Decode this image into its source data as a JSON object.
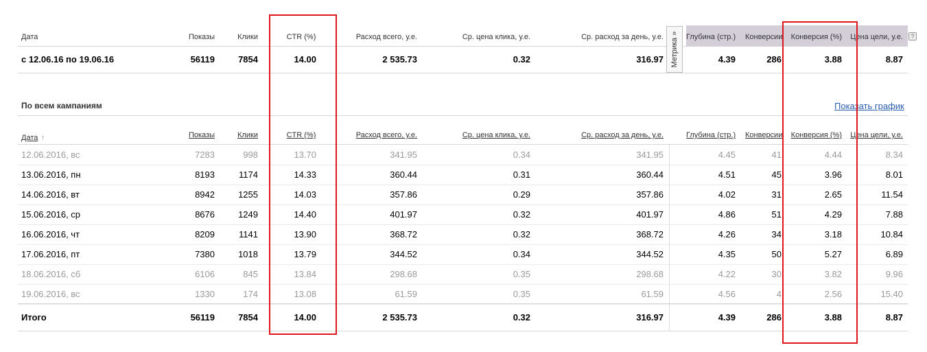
{
  "columns": [
    "Дата",
    "Показы",
    "Клики",
    "CTR (%)",
    "Расход всего, у.е.",
    "Ср. цена клика, у.е.",
    "Ср. расход за день, у.е.",
    "Глубина (стр.)",
    "Конверсии",
    "Конверсия (%)",
    "Цена цели, у.е."
  ],
  "sort_arrow": "↑",
  "metrika_label": "Метрика »",
  "help_label": "?",
  "summary": {
    "date": "с 12.06.16 по 19.06.16",
    "shows": "56119",
    "clicks": "7854",
    "ctr": "14.00",
    "cost": "2 535.73",
    "cpc": "0.32",
    "daily": "316.97",
    "depth": "4.39",
    "conv": "286",
    "conv_pct": "3.88",
    "goal_price": "8.87"
  },
  "section_title": "По всем кампаниям",
  "show_graph": "Показать график",
  "rows": [
    {
      "date": "12.06.2016, вс",
      "shows": "7283",
      "clicks": "998",
      "ctr": "13.70",
      "cost": "341.95",
      "cpc": "0.34",
      "daily": "341.95",
      "depth": "4.45",
      "conv": "41",
      "conv_pct": "4.44",
      "goal_price": "8.34",
      "muted": true
    },
    {
      "date": "13.06.2016, пн",
      "shows": "8193",
      "clicks": "1174",
      "ctr": "14.33",
      "cost": "360.44",
      "cpc": "0.31",
      "daily": "360.44",
      "depth": "4.51",
      "conv": "45",
      "conv_pct": "3.96",
      "goal_price": "8.01",
      "muted": false
    },
    {
      "date": "14.06.2016, вт",
      "shows": "8942",
      "clicks": "1255",
      "ctr": "14.03",
      "cost": "357.86",
      "cpc": "0.29",
      "daily": "357.86",
      "depth": "4.02",
      "conv": "31",
      "conv_pct": "2.65",
      "goal_price": "11.54",
      "muted": false
    },
    {
      "date": "15.06.2016, ср",
      "shows": "8676",
      "clicks": "1249",
      "ctr": "14.40",
      "cost": "401.97",
      "cpc": "0.32",
      "daily": "401.97",
      "depth": "4.86",
      "conv": "51",
      "conv_pct": "4.29",
      "goal_price": "7.88",
      "muted": false
    },
    {
      "date": "16.06.2016, чт",
      "shows": "8209",
      "clicks": "1141",
      "ctr": "13.90",
      "cost": "368.72",
      "cpc": "0.32",
      "daily": "368.72",
      "depth": "4.26",
      "conv": "34",
      "conv_pct": "3.18",
      "goal_price": "10.84",
      "muted": false
    },
    {
      "date": "17.06.2016, пт",
      "shows": "7380",
      "clicks": "1018",
      "ctr": "13.79",
      "cost": "344.52",
      "cpc": "0.34",
      "daily": "344.52",
      "depth": "4.35",
      "conv": "50",
      "conv_pct": "5.27",
      "goal_price": "6.89",
      "muted": false
    },
    {
      "date": "18.06.2016, сб",
      "shows": "6106",
      "clicks": "845",
      "ctr": "13.84",
      "cost": "298.68",
      "cpc": "0.35",
      "daily": "298.68",
      "depth": "4.22",
      "conv": "30",
      "conv_pct": "3.82",
      "goal_price": "9.96",
      "muted": true
    },
    {
      "date": "19.06.2016, вс",
      "shows": "1330",
      "clicks": "174",
      "ctr": "13.08",
      "cost": "61.59",
      "cpc": "0.35",
      "daily": "61.59",
      "depth": "4.56",
      "conv": "4",
      "conv_pct": "2.56",
      "goal_price": "15.40",
      "muted": true
    }
  ],
  "total": {
    "label": "Итого",
    "shows": "56119",
    "clicks": "7854",
    "ctr": "14.00",
    "cost": "2 535.73",
    "cpc": "0.32",
    "daily": "316.97",
    "depth": "4.39",
    "conv": "286",
    "conv_pct": "3.88",
    "goal_price": "8.87"
  },
  "colors": {
    "highlight_box": "#e0141b",
    "metrika_header_bg": "#d3ced8",
    "link": "#2a5db0",
    "muted_text": "#9a9a9a"
  }
}
